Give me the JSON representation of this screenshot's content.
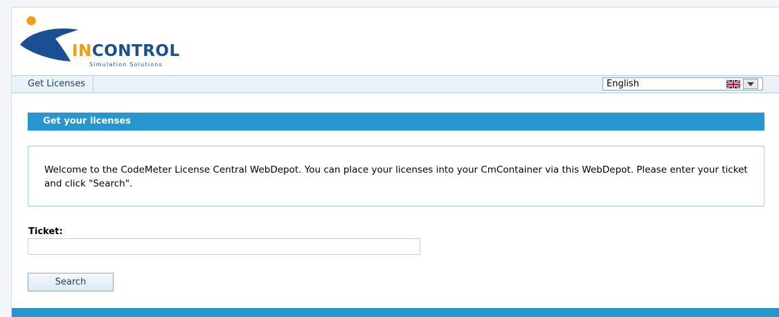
{
  "brand": {
    "logo_text_highlight": "IN",
    "logo_text_rest": "CONTROL",
    "tagline": "Simulation Solutions",
    "colors": {
      "accent": "#f39c12",
      "primary": "#1a4f94",
      "banner": "#2696d1"
    }
  },
  "nav": {
    "items": [
      {
        "label": "Get Licenses"
      }
    ],
    "language": {
      "selected": "English",
      "flag_icon": "uk-flag-icon"
    }
  },
  "section": {
    "title": "Get your licenses"
  },
  "info": {
    "text": "Welcome to the CodeMeter License Central WebDepot. You can place your licenses into your CmContainer via this WebDepot. Please enter your ticket and click \"Search\"."
  },
  "form": {
    "ticket_label": "Ticket:",
    "ticket_value": "",
    "search_label": "Search"
  }
}
